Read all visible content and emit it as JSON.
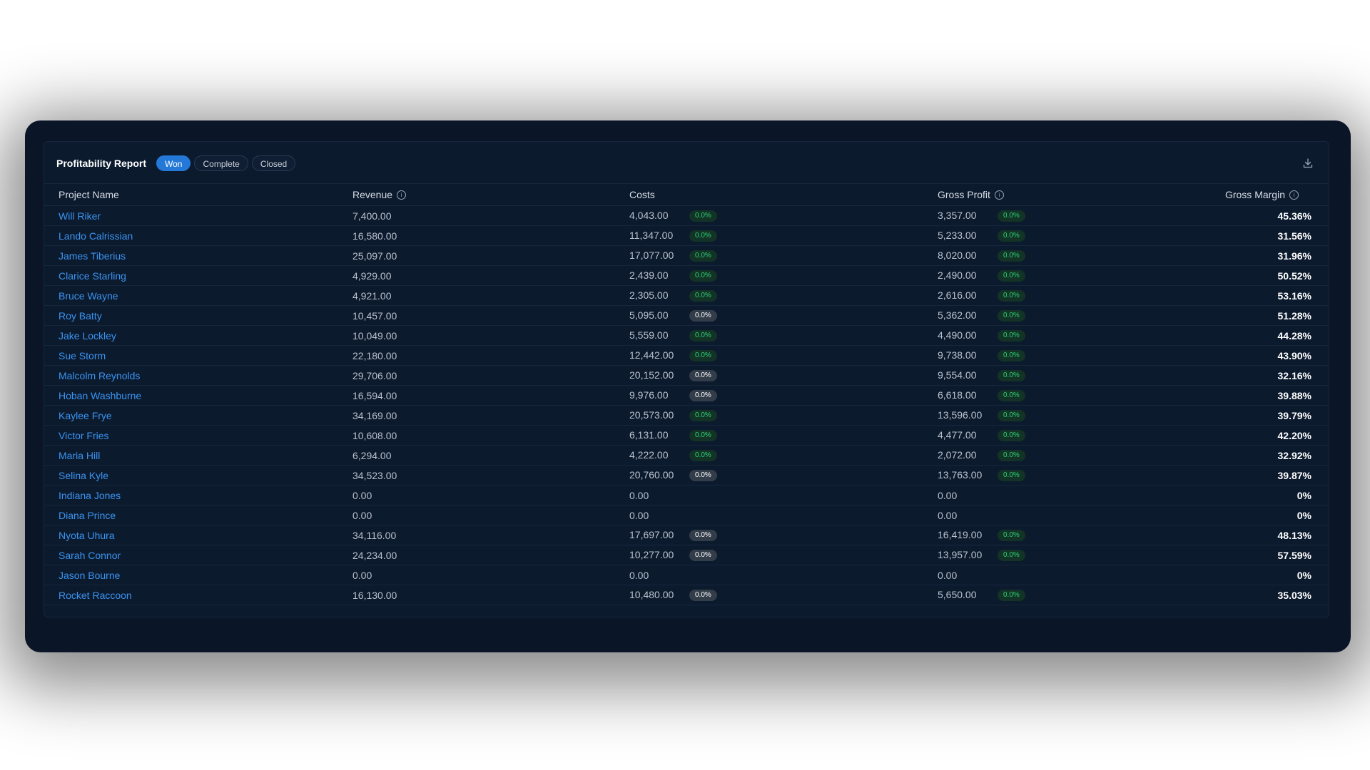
{
  "report": {
    "title": "Profitability Report",
    "filters": [
      "Won",
      "Complete",
      "Closed"
    ],
    "active_filter": "Won"
  },
  "table": {
    "headers": {
      "name": "Project Name",
      "revenue": "Revenue",
      "costs": "Costs",
      "gross_profit": "Gross Profit",
      "gross_margin": "Gross Margin"
    },
    "rows": [
      {
        "name": "Will Riker",
        "revenue": "7,400.00",
        "costs": "4,043.00",
        "costs_badge": "0.0%",
        "costs_badge_style": "green",
        "profit": "3,357.00",
        "profit_badge": "0.0%",
        "margin": "45.36%"
      },
      {
        "name": "Lando Calrissian",
        "revenue": "16,580.00",
        "costs": "11,347.00",
        "costs_badge": "0.0%",
        "costs_badge_style": "green",
        "profit": "5,233.00",
        "profit_badge": "0.0%",
        "margin": "31.56%"
      },
      {
        "name": "James Tiberius",
        "revenue": "25,097.00",
        "costs": "17,077.00",
        "costs_badge": "0.0%",
        "costs_badge_style": "green",
        "profit": "8,020.00",
        "profit_badge": "0.0%",
        "margin": "31.96%"
      },
      {
        "name": "Clarice Starling",
        "revenue": "4,929.00",
        "costs": "2,439.00",
        "costs_badge": "0.0%",
        "costs_badge_style": "green",
        "profit": "2,490.00",
        "profit_badge": "0.0%",
        "margin": "50.52%"
      },
      {
        "name": "Bruce Wayne",
        "revenue": "4,921.00",
        "costs": "2,305.00",
        "costs_badge": "0.0%",
        "costs_badge_style": "green",
        "profit": "2,616.00",
        "profit_badge": "0.0%",
        "margin": "53.16%"
      },
      {
        "name": "Roy Batty",
        "revenue": "10,457.00",
        "costs": "5,095.00",
        "costs_badge": "0.0%",
        "costs_badge_style": "gray",
        "profit": "5,362.00",
        "profit_badge": "0.0%",
        "margin": "51.28%"
      },
      {
        "name": "Jake Lockley",
        "revenue": "10,049.00",
        "costs": "5,559.00",
        "costs_badge": "0.0%",
        "costs_badge_style": "green",
        "profit": "4,490.00",
        "profit_badge": "0.0%",
        "margin": "44.28%"
      },
      {
        "name": "Sue Storm",
        "revenue": "22,180.00",
        "costs": "12,442.00",
        "costs_badge": "0.0%",
        "costs_badge_style": "green",
        "profit": "9,738.00",
        "profit_badge": "0.0%",
        "margin": "43.90%"
      },
      {
        "name": "Malcolm Reynolds",
        "revenue": "29,706.00",
        "costs": "20,152.00",
        "costs_badge": "0.0%",
        "costs_badge_style": "gray",
        "profit": "9,554.00",
        "profit_badge": "0.0%",
        "margin": "32.16%"
      },
      {
        "name": "Hoban Washburne",
        "revenue": "16,594.00",
        "costs": "9,976.00",
        "costs_badge": "0.0%",
        "costs_badge_style": "gray",
        "profit": "6,618.00",
        "profit_badge": "0.0%",
        "margin": "39.88%"
      },
      {
        "name": "Kaylee Frye",
        "revenue": "34,169.00",
        "costs": "20,573.00",
        "costs_badge": "0.0%",
        "costs_badge_style": "green",
        "profit": "13,596.00",
        "profit_badge": "0.0%",
        "margin": "39.79%"
      },
      {
        "name": "Victor Fries",
        "revenue": "10,608.00",
        "costs": "6,131.00",
        "costs_badge": "0.0%",
        "costs_badge_style": "green",
        "profit": "4,477.00",
        "profit_badge": "0.0%",
        "margin": "42.20%"
      },
      {
        "name": "Maria Hill",
        "revenue": "6,294.00",
        "costs": "4,222.00",
        "costs_badge": "0.0%",
        "costs_badge_style": "green",
        "profit": "2,072.00",
        "profit_badge": "0.0%",
        "margin": "32.92%"
      },
      {
        "name": "Selina Kyle",
        "revenue": "34,523.00",
        "costs": "20,760.00",
        "costs_badge": "0.0%",
        "costs_badge_style": "gray",
        "profit": "13,763.00",
        "profit_badge": "0.0%",
        "margin": "39.87%"
      },
      {
        "name": "Indiana Jones",
        "revenue": "0.00",
        "costs": "0.00",
        "costs_badge": "",
        "costs_badge_style": "",
        "profit": "0.00",
        "profit_badge": "",
        "margin": "0%"
      },
      {
        "name": "Diana Prince",
        "revenue": "0.00",
        "costs": "0.00",
        "costs_badge": "",
        "costs_badge_style": "",
        "profit": "0.00",
        "profit_badge": "",
        "margin": "0%"
      },
      {
        "name": "Nyota Uhura",
        "revenue": "34,116.00",
        "costs": "17,697.00",
        "costs_badge": "0.0%",
        "costs_badge_style": "gray",
        "profit": "16,419.00",
        "profit_badge": "0.0%",
        "margin": "48.13%"
      },
      {
        "name": "Sarah Connor",
        "revenue": "24,234.00",
        "costs": "10,277.00",
        "costs_badge": "0.0%",
        "costs_badge_style": "gray",
        "profit": "13,957.00",
        "profit_badge": "0.0%",
        "margin": "57.59%"
      },
      {
        "name": "Jason Bourne",
        "revenue": "0.00",
        "costs": "0.00",
        "costs_badge": "",
        "costs_badge_style": "",
        "profit": "0.00",
        "profit_badge": "",
        "margin": "0%"
      },
      {
        "name": "Rocket Raccoon",
        "revenue": "16,130.00",
        "costs": "10,480.00",
        "costs_badge": "0.0%",
        "costs_badge_style": "gray",
        "profit": "5,650.00",
        "profit_badge": "0.0%",
        "margin": "35.03%"
      }
    ]
  },
  "colors": {
    "background": "#0a1527",
    "link": "#3a94f0",
    "active_chip": "#2479d8",
    "badge_green_bg": "#123325",
    "badge_green_text": "#2fd27a",
    "badge_gray_bg": "#333d4a"
  },
  "icons": {
    "download": "download-icon",
    "info": "info-icon"
  }
}
